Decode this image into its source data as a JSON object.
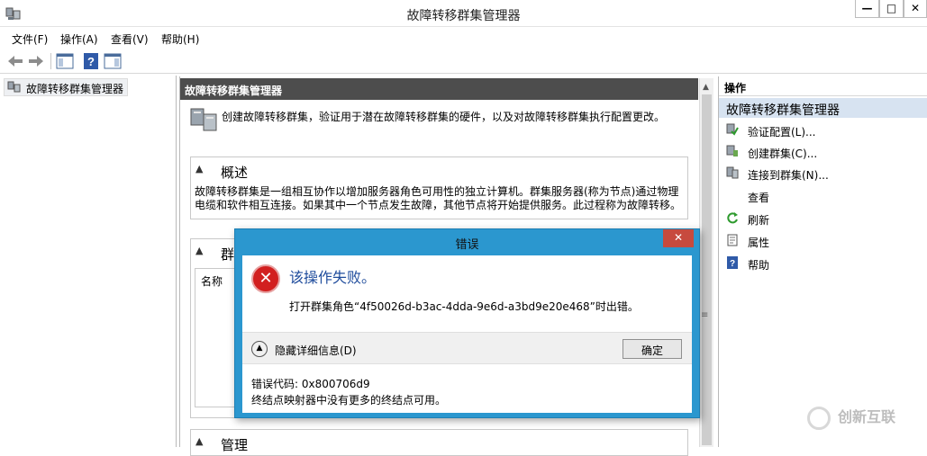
{
  "window": {
    "title": "故障转移群集管理器"
  },
  "window_buttons": {
    "minimize": "—",
    "maximize": "□",
    "close": "✕"
  },
  "menu": [
    "文件(F)",
    "操作(A)",
    "查看(V)",
    "帮助(H)"
  ],
  "toolbar": {
    "icons": [
      "back-arrow-icon",
      "forward-arrow-icon",
      "console-tree-icon",
      "help-icon",
      "action-pane-icon"
    ]
  },
  "tree": {
    "root": "故障转移群集管理器"
  },
  "center": {
    "header": "故障转移群集管理器",
    "intro": "创建故障转移群集，验证用于潜在故障转移群集的硬件，以及对故障转移群集执行配置更改。",
    "overview": {
      "label": "概述",
      "text": "故障转移群集是一组相互协作以增加服务器角色可用性的独立计算机。群集服务器(称为节点)通过物理电缆和软件相互连接。如果其中一个节点发生故障，其他节点将开始提供服务。此过程称为故障转移。"
    },
    "clusters": {
      "label": "群",
      "column": "名称"
    },
    "manage": {
      "label": "管理"
    }
  },
  "actions": {
    "header": "操作",
    "subheader": "故障转移群集管理器",
    "items": [
      {
        "label": "验证配置(L)...",
        "icon": "validate-icon"
      },
      {
        "label": "创建群集(C)...",
        "icon": "create-cluster-icon"
      },
      {
        "label": "连接到群集(N)...",
        "icon": "connect-cluster-icon"
      },
      {
        "label": "查看",
        "icon": ""
      },
      {
        "label": "刷新",
        "icon": "refresh-icon"
      },
      {
        "label": "属性",
        "icon": "properties-icon"
      },
      {
        "label": "帮助",
        "icon": "help-icon"
      }
    ]
  },
  "dialog": {
    "title": "错误",
    "close": "✕",
    "main": "该操作失败。",
    "detail": "打开群集角色“4f50026d-b3ac-4dda-9e6d-a3bd9e20e468”时出错。",
    "toggle_label": "隐藏详细信息(D)",
    "ok": "确定",
    "error_code": "错误代码: 0x800706d9",
    "error_msg": "终结点映射器中没有更多的终结点可用。"
  },
  "watermark": "创新互联",
  "colors": {
    "dialog_border": "#2b97cf",
    "close_red": "#c74a3e",
    "header_dark": "#4d4d4d",
    "actions_sub": "#d7e3f1",
    "error_title": "#1f4c9c"
  }
}
